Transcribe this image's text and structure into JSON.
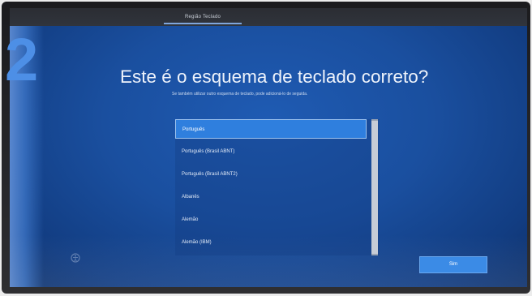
{
  "header": {
    "tab_label": "Região Teclado"
  },
  "step": {
    "number": "2"
  },
  "main": {
    "title": "Este é o esquema de teclado correto?",
    "subtitle": "Se também utilizar outro esquema de teclado, pode adicioná-lo de seguida."
  },
  "layout_list": {
    "items": [
      {
        "label": "Português",
        "selected": true
      },
      {
        "label": "Português (Brasil ABNT)",
        "selected": false
      },
      {
        "label": "Português (Brasil ABNT2)",
        "selected": false
      },
      {
        "label": "Albanês",
        "selected": false
      },
      {
        "label": "Alemão",
        "selected": false
      },
      {
        "label": "Alemão (IBM)",
        "selected": false
      }
    ]
  },
  "footer": {
    "next_label": "Sim"
  },
  "colors": {
    "background_blue": "#1a4f9f",
    "selection_blue": "#2f7fde",
    "button_blue": "#3b8be6",
    "step_number_blue": "#4d8fe6"
  },
  "icons": {
    "accessibility": "accessibility-icon"
  }
}
